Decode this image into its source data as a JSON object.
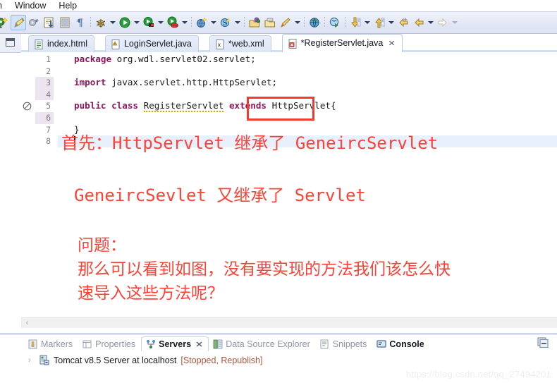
{
  "menu": {
    "items": [
      "n",
      "Window",
      "Help"
    ]
  },
  "toolbar": {
    "groups": [
      {
        "icons": [
          "new-wizard-icon",
          "edit-highlight-icon",
          "skip-breakpoints-icon",
          "save-icon",
          "print-icon",
          "paragraph-mark-icon"
        ]
      },
      {
        "icons": [
          "debug-icon",
          "run-icon",
          "run-server-icon",
          "stop-server-icon"
        ]
      },
      {
        "icons": [
          "open-web-browser-icon",
          "search-icon"
        ]
      },
      {
        "icons": [
          "open-type-icon",
          "open-task-icon",
          "new-java-class-icon"
        ]
      },
      {
        "icons": [
          "open-resource-icon",
          "open-perspective-icon",
          "pencil-icon"
        ]
      },
      {
        "icons": [
          "globe-icon"
        ]
      },
      {
        "icons": [
          "run-last-tool-icon"
        ]
      },
      {
        "icons": [
          "next-annotation-icon",
          "previous-annotation-icon"
        ]
      },
      {
        "icons": [
          "back-icon",
          "forward-icon",
          "next-icon"
        ]
      }
    ]
  },
  "left_panel": {
    "restore_icon": "restore-view-icon"
  },
  "editor": {
    "tabs": [
      {
        "label": "index.html",
        "icon": "html-file-icon",
        "active": false,
        "dirty": false
      },
      {
        "label": "LoginServlet.java",
        "icon": "java-file-warning-icon",
        "active": false,
        "dirty": false
      },
      {
        "label": "*web.xml",
        "icon": "xml-file-icon",
        "active": false,
        "dirty": true
      },
      {
        "label": "*RegisterServlet.java",
        "icon": "java-file-error-icon",
        "active": true,
        "dirty": true,
        "close": "✕"
      }
    ],
    "line_numbers": [
      "1",
      "2",
      "3",
      "4",
      "5",
      "6",
      "7",
      "8"
    ],
    "lines": [
      {
        "n": 1,
        "tokens": [
          {
            "t": "package",
            "c": "kw"
          },
          {
            "t": " org.wdl.servlet02.servlet;",
            "c": "pl"
          }
        ]
      },
      {
        "n": 2,
        "tokens": []
      },
      {
        "n": 3,
        "tokens": [
          {
            "t": "import",
            "c": "kw"
          },
          {
            "t": " javax.servlet.http.HttpServlet;",
            "c": "pl"
          }
        ]
      },
      {
        "n": 4,
        "tokens": []
      },
      {
        "n": 5,
        "tokens": [
          {
            "t": "public",
            "c": "kw"
          },
          {
            "t": " ",
            "c": "pl"
          },
          {
            "t": "class",
            "c": "kw"
          },
          {
            "t": " ",
            "c": "pl"
          },
          {
            "t": "RegisterServlet",
            "c": "squig"
          },
          {
            "t": " ",
            "c": "pl"
          },
          {
            "t": "extends",
            "c": "kw"
          },
          {
            "t": " ",
            "c": "pl"
          },
          {
            "t": "HttpServlet{",
            "c": "pl"
          }
        ]
      },
      {
        "n": 6,
        "tokens": []
      },
      {
        "n": 7,
        "tokens": [
          {
            "t": "}",
            "c": "pl"
          }
        ]
      },
      {
        "n": 8,
        "tokens": []
      }
    ],
    "error_marker": "error-marker-icon",
    "focus_box": "httpservlet-focus-box",
    "hscrollbar_left_arrow": "‹"
  },
  "annotations": [
    {
      "name": "annotation-line-1",
      "text": "首先：HttpServlet 继承了 GeneircServlet"
    },
    {
      "name": "annotation-line-2",
      "text": "GeneircSevlet 又继承了 Servlet"
    },
    {
      "name": "annotation-question-title",
      "text": "问题："
    },
    {
      "name": "annotation-question-body-1",
      "text": "那么可以看到如图，没有要实现的方法我们该怎么快"
    },
    {
      "name": "annotation-question-body-2",
      "text": "速导入这些方法呢？"
    }
  ],
  "bottom_panel": {
    "tabs": [
      {
        "label": "Markers",
        "icon": "markers-icon",
        "active": false,
        "bold": false
      },
      {
        "label": "Properties",
        "icon": "properties-icon",
        "active": false,
        "bold": false
      },
      {
        "label": "Servers",
        "icon": "servers-icon",
        "active": true,
        "bold": true,
        "close": "✕"
      },
      {
        "label": "Data Source Explorer",
        "icon": "data-source-explorer-icon",
        "active": false,
        "bold": false
      },
      {
        "label": "Snippets",
        "icon": "snippets-icon",
        "active": false,
        "bold": false
      },
      {
        "label": "Console",
        "icon": "console-icon",
        "active": false,
        "bold": true
      }
    ],
    "server": {
      "twisty": "›",
      "icon": "tomcat-server-icon",
      "name": "Tomcat v8.5 Server at localhost",
      "status": "[Stopped, Republish]"
    },
    "minimize_icon": "minimize-view-icon"
  },
  "watermark": {
    "text": "https://blog.csdn.net/qq_27494201"
  },
  "colors": {
    "annotation_red": "#ff4136",
    "focus_box_red": "#f23b2f",
    "keyword": "#8b1a5c",
    "toolbar_bg": "#e4e9f5",
    "tab_active_bg": "#ffffff",
    "highlight_line": "#e8f0fb"
  }
}
